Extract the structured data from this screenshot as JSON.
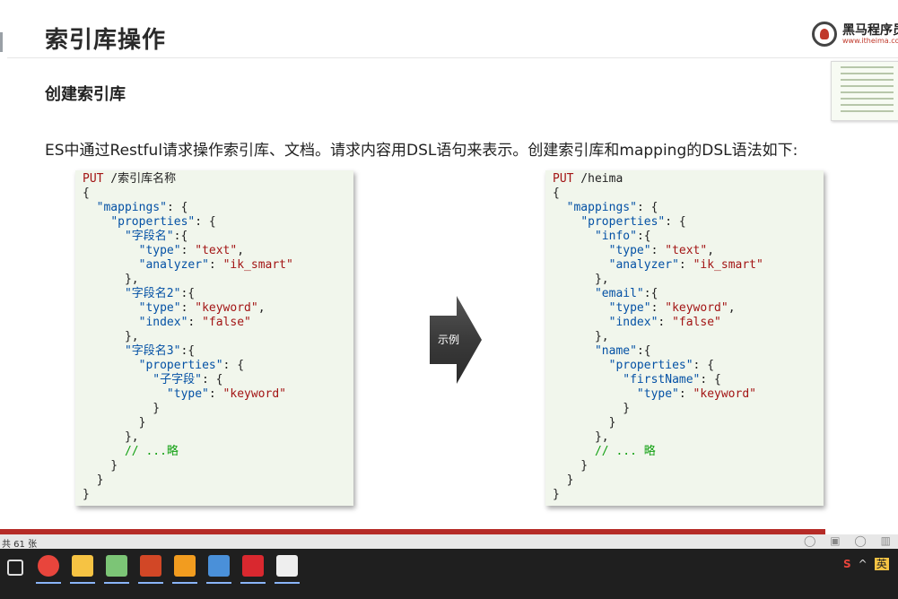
{
  "slide": {
    "title": "索引库操作",
    "subtitle": "创建索引库",
    "description": "ES中通过Restful请求操作索引库、文档。请求内容用DSL语句来表示。创建索引库和mapping的DSL语法如下:",
    "logo_text": "黑马程序员",
    "logo_url": "www.itheima.com",
    "arrow_label": "示例"
  },
  "code_left": {
    "lines": [
      [
        [
          "k",
          "PUT"
        ],
        [
          "p",
          " /索引库名称"
        ]
      ],
      [
        [
          "p",
          "{"
        ]
      ],
      [
        [
          "p",
          "  "
        ],
        [
          "s",
          "\"mappings\""
        ],
        [
          "p",
          ": {"
        ]
      ],
      [
        [
          "p",
          "    "
        ],
        [
          "s",
          "\"properties\""
        ],
        [
          "p",
          ": {"
        ]
      ],
      [
        [
          "p",
          "      "
        ],
        [
          "s",
          "\"字段名\""
        ],
        [
          "p",
          ":{"
        ]
      ],
      [
        [
          "p",
          "        "
        ],
        [
          "s",
          "\"type\""
        ],
        [
          "p",
          ": "
        ],
        [
          "v",
          "\"text\""
        ],
        [
          "p",
          ","
        ]
      ],
      [
        [
          "p",
          "        "
        ],
        [
          "s",
          "\"analyzer\""
        ],
        [
          "p",
          ": "
        ],
        [
          "v",
          "\"ik_smart\""
        ]
      ],
      [
        [
          "p",
          "      },"
        ]
      ],
      [
        [
          "p",
          "      "
        ],
        [
          "s",
          "\"字段名2\""
        ],
        [
          "p",
          ":{"
        ]
      ],
      [
        [
          "p",
          "        "
        ],
        [
          "s",
          "\"type\""
        ],
        [
          "p",
          ": "
        ],
        [
          "v",
          "\"keyword\""
        ],
        [
          "p",
          ","
        ]
      ],
      [
        [
          "p",
          "        "
        ],
        [
          "s",
          "\"index\""
        ],
        [
          "p",
          ": "
        ],
        [
          "v",
          "\"false\""
        ]
      ],
      [
        [
          "p",
          "      },"
        ]
      ],
      [
        [
          "p",
          "      "
        ],
        [
          "s",
          "\"字段名3\""
        ],
        [
          "p",
          ":{"
        ]
      ],
      [
        [
          "p",
          "        "
        ],
        [
          "s",
          "\"properties\""
        ],
        [
          "p",
          ": {"
        ]
      ],
      [
        [
          "p",
          "          "
        ],
        [
          "s",
          "\"子字段\""
        ],
        [
          "p",
          ": {"
        ]
      ],
      [
        [
          "p",
          "            "
        ],
        [
          "s",
          "\"type\""
        ],
        [
          "p",
          ": "
        ],
        [
          "v",
          "\"keyword\""
        ]
      ],
      [
        [
          "p",
          "          }"
        ]
      ],
      [
        [
          "p",
          "        }"
        ]
      ],
      [
        [
          "p",
          "      },"
        ]
      ],
      [
        [
          "p",
          "      "
        ],
        [
          "c",
          "// ...略"
        ]
      ],
      [
        [
          "p",
          "    }"
        ]
      ],
      [
        [
          "p",
          "  }"
        ]
      ],
      [
        [
          "p",
          "}"
        ]
      ]
    ]
  },
  "code_right": {
    "lines": [
      [
        [
          "k",
          "PUT"
        ],
        [
          "p",
          " /heima"
        ]
      ],
      [
        [
          "p",
          "{"
        ]
      ],
      [
        [
          "p",
          "  "
        ],
        [
          "s",
          "\"mappings\""
        ],
        [
          "p",
          ": {"
        ]
      ],
      [
        [
          "p",
          "    "
        ],
        [
          "s",
          "\"properties\""
        ],
        [
          "p",
          ": {"
        ]
      ],
      [
        [
          "p",
          "      "
        ],
        [
          "s",
          "\"info\""
        ],
        [
          "p",
          ":{"
        ]
      ],
      [
        [
          "p",
          "        "
        ],
        [
          "s",
          "\"type\""
        ],
        [
          "p",
          ": "
        ],
        [
          "v",
          "\"text\""
        ],
        [
          "p",
          ","
        ]
      ],
      [
        [
          "p",
          "        "
        ],
        [
          "s",
          "\"analyzer\""
        ],
        [
          "p",
          ": "
        ],
        [
          "v",
          "\"ik_smart\""
        ]
      ],
      [
        [
          "p",
          "      },"
        ]
      ],
      [
        [
          "p",
          "      "
        ],
        [
          "s",
          "\"email\""
        ],
        [
          "p",
          ":{"
        ]
      ],
      [
        [
          "p",
          "        "
        ],
        [
          "s",
          "\"type\""
        ],
        [
          "p",
          ": "
        ],
        [
          "v",
          "\"keyword\""
        ],
        [
          "p",
          ","
        ]
      ],
      [
        [
          "p",
          "        "
        ],
        [
          "s",
          "\"index\""
        ],
        [
          "p",
          ": "
        ],
        [
          "v",
          "\"false\""
        ]
      ],
      [
        [
          "p",
          "      },"
        ]
      ],
      [
        [
          "p",
          "      "
        ],
        [
          "s",
          "\"name\""
        ],
        [
          "p",
          ":{"
        ]
      ],
      [
        [
          "p",
          "        "
        ],
        [
          "s",
          "\"properties\""
        ],
        [
          "p",
          ": {"
        ]
      ],
      [
        [
          "p",
          "          "
        ],
        [
          "s",
          "\"firstName\""
        ],
        [
          "p",
          ": {"
        ]
      ],
      [
        [
          "p",
          "            "
        ],
        [
          "s",
          "\"type\""
        ],
        [
          "p",
          ": "
        ],
        [
          "v",
          "\"keyword\""
        ]
      ],
      [
        [
          "p",
          "          }"
        ]
      ],
      [
        [
          "p",
          "        }"
        ]
      ],
      [
        [
          "p",
          "      },"
        ]
      ],
      [
        [
          "p",
          "      "
        ],
        [
          "c",
          "// ... 略"
        ]
      ],
      [
        [
          "p",
          "    }"
        ]
      ],
      [
        [
          "p",
          "  }"
        ]
      ],
      [
        [
          "p",
          "}"
        ]
      ]
    ]
  },
  "status_bar": {
    "slide_count": "共 61 张"
  },
  "taskbar": {
    "items": [
      {
        "name": "task-view-icon",
        "color": "#1f1f1f"
      },
      {
        "name": "chrome-icon",
        "color": "#e8453c"
      },
      {
        "name": "file-explorer-icon",
        "color": "#f6c343"
      },
      {
        "name": "notepad-plus-plus-icon",
        "color": "#7cc576"
      },
      {
        "name": "powerpoint-icon",
        "color": "#d24726"
      },
      {
        "name": "vmware-icon",
        "color": "#f29c1f"
      },
      {
        "name": "remote-desktop-icon",
        "color": "#4a90d9"
      },
      {
        "name": "app-icon-red",
        "color": "#d9282f"
      },
      {
        "name": "typora-icon",
        "color": "#eeeeee"
      }
    ]
  },
  "colors": {
    "accent_red": "#b52b27",
    "code_bg": "#f1f6ec",
    "keyword": "#a31515",
    "string_key": "#0451a5",
    "comment": "#12a012"
  }
}
